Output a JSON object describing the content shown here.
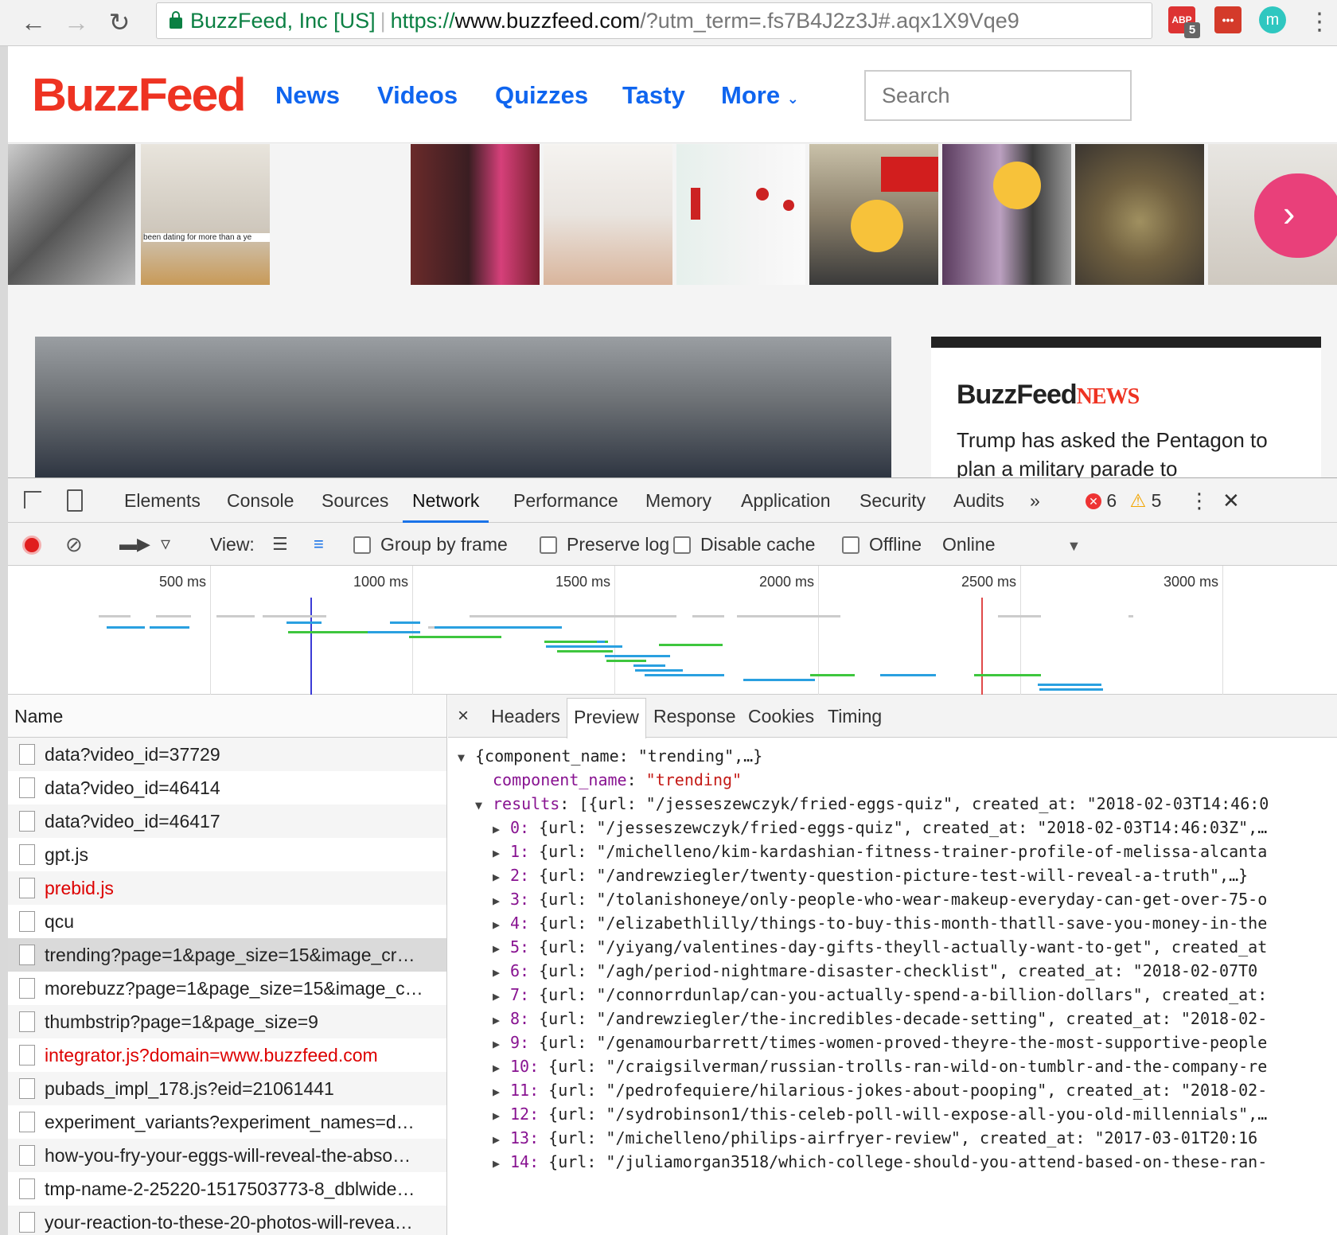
{
  "browser": {
    "org": "BuzzFeed, Inc [US]",
    "url_scheme": "https://",
    "url_host": "www.buzzfeed.com",
    "url_path": "/?utm_term=.fs7B4J2z3J#.aqx1X9Vqe9",
    "ext_abp": "ABP",
    "ext_abp_badge": "5",
    "ext_meta": "•••",
    "ext_profile": "m"
  },
  "site": {
    "logo": "BuzzFeed",
    "nav": [
      "News",
      "Videos",
      "Quizzes",
      "Tasty",
      "More"
    ],
    "search_placeholder": "Search",
    "news_logo_a": "BuzzFeed",
    "news_logo_b": "NEWS",
    "headline": "Trump has asked the Pentagon to plan a military parade to",
    "thumb_caption_1": "been dating for more than a ye"
  },
  "devtools": {
    "tabs": [
      "Elements",
      "Console",
      "Sources",
      "Network",
      "Performance",
      "Memory",
      "Application",
      "Security",
      "Audits"
    ],
    "errors": "6",
    "warnings": "5",
    "toolbar": {
      "view": "View:",
      "group_by_frame": "Group by frame",
      "preserve_log": "Preserve log",
      "disable_cache": "Disable cache",
      "offline": "Offline",
      "online": "Online"
    },
    "timeline_labels": [
      "500 ms",
      "1000 ms",
      "1500 ms",
      "2000 ms",
      "2500 ms",
      "3000 ms"
    ],
    "name_header": "Name",
    "requests": [
      {
        "name": "data?video_id=37729",
        "error": false
      },
      {
        "name": "data?video_id=46414",
        "error": false
      },
      {
        "name": "data?video_id=46417",
        "error": false
      },
      {
        "name": "gpt.js",
        "error": false
      },
      {
        "name": "prebid.js",
        "error": true
      },
      {
        "name": "qcu",
        "error": false
      },
      {
        "name": "trending?page=1&page_size=15&image_cr…",
        "error": false,
        "selected": true
      },
      {
        "name": "morebuzz?page=1&page_size=15&image_c…",
        "error": false
      },
      {
        "name": "thumbstrip?page=1&page_size=9",
        "error": false
      },
      {
        "name": "integrator.js?domain=www.buzzfeed.com",
        "error": true
      },
      {
        "name": "pubads_impl_178.js?eid=21061441",
        "error": false
      },
      {
        "name": "experiment_variants?experiment_names=d…",
        "error": false
      },
      {
        "name": "how-you-fry-your-eggs-will-reveal-the-abso…",
        "error": false
      },
      {
        "name": "tmp-name-2-25220-1517503773-8_dblwide…",
        "error": false
      },
      {
        "name": "your-reaction-to-these-20-photos-will-revea…",
        "error": false
      }
    ],
    "detail_tabs": [
      "Headers",
      "Preview",
      "Response",
      "Cookies",
      "Timing"
    ],
    "close_glyph": "×",
    "preview": {
      "root": "{component_name: \"trending\",…}",
      "component_key": "component_name",
      "component_value": "\"trending\"",
      "results_key": "results",
      "results_summary": "[{url: \"/jesseszewczyk/fried-eggs-quiz\", created_at: \"2018-02-03T14:46:0",
      "items": [
        "{url: \"/jesseszewczyk/fried-eggs-quiz\", created_at: \"2018-02-03T14:46:03Z\",…",
        "{url: \"/michelleno/kim-kardashian-fitness-trainer-profile-of-melissa-alcanta",
        "{url: \"/andrewziegler/twenty-question-picture-test-will-reveal-a-truth\",…}",
        "{url: \"/tolanishoneye/only-people-who-wear-makeup-everyday-can-get-over-75-o",
        "{url: \"/elizabethlilly/things-to-buy-this-month-thatll-save-you-money-in-the",
        "{url: \"/yiyang/valentines-day-gifts-theyll-actually-want-to-get\", created_at",
        "{url: \"/agh/period-nightmare-disaster-checklist\", created_at: \"2018-02-07T0",
        "{url: \"/connorrdunlap/can-you-actually-spend-a-billion-dollars\", created_at:",
        "{url: \"/andrewziegler/the-incredibles-decade-setting\", created_at: \"2018-02-",
        "{url: \"/genamourbarrett/times-women-proved-theyre-the-most-supportive-people",
        "{url: \"/craigsilverman/russian-trolls-ran-wild-on-tumblr-and-the-company-re",
        "{url: \"/pedrofequiere/hilarious-jokes-about-pooping\", created_at: \"2018-02-",
        "{url: \"/sydrobinson1/this-celeb-poll-will-expose-all-you-old-millennials\",…",
        "{url: \"/michelleno/philips-airfryer-review\", created_at: \"2017-03-01T20:16",
        "{url: \"/juliamorgan3518/which-college-should-you-attend-based-on-these-ran-"
      ]
    }
  }
}
